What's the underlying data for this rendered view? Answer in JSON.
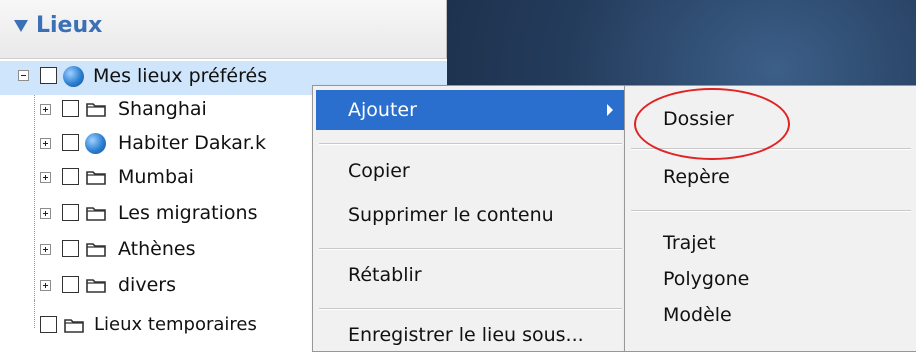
{
  "panel": {
    "title": "Lieux"
  },
  "tree": {
    "root": {
      "label": "Mes lieux préférés"
    },
    "items": [
      {
        "label": "Shanghai",
        "icon": "folder-icon"
      },
      {
        "label": "Habiter Dakar.k",
        "icon": "globe-icon"
      },
      {
        "label": "Mumbai",
        "icon": "folder-icon"
      },
      {
        "label": "Les migrations",
        "icon": "folder-icon"
      },
      {
        "label": "Athènes",
        "icon": "folder-icon"
      },
      {
        "label": "divers",
        "icon": "folder-icon"
      }
    ],
    "temp": {
      "label": "Lieux temporaires"
    }
  },
  "context_menu": {
    "add": "Ajouter",
    "copy": "Copier",
    "delete_content": "Supprimer le contenu",
    "restore": "Rétablir",
    "save_as": "Enregistrer le lieu sous..."
  },
  "submenu": {
    "folder": "Dossier",
    "placemark": "Repère",
    "path": "Trajet",
    "polygon": "Polygone",
    "model": "Modèle"
  },
  "colors": {
    "highlight": "#2b6fce",
    "selection": "#cfe5fb",
    "ring": "#e02323",
    "header_text": "#3b6fb6"
  }
}
